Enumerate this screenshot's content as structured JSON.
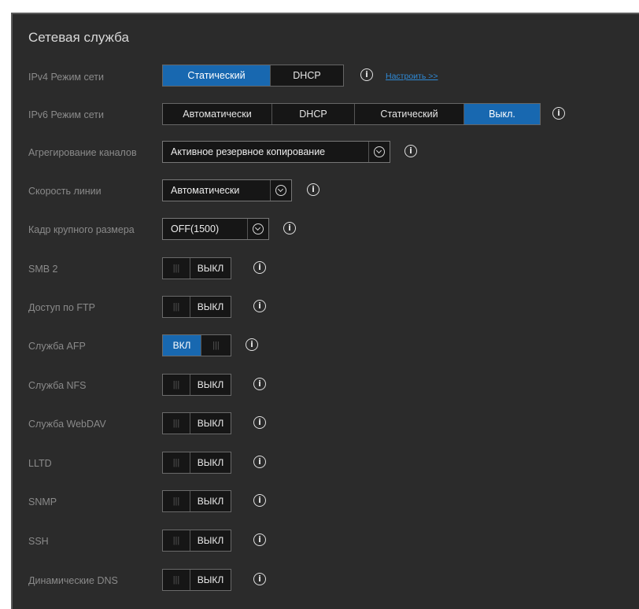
{
  "section_title": "Сетевая служба",
  "ipv4": {
    "label": "IPv4 Режим сети",
    "options": [
      "Статический",
      "DHCP"
    ],
    "selected": "Статический",
    "configure_link": "Настроить >>"
  },
  "ipv6": {
    "label": "IPv6 Режим сети",
    "options": [
      "Автоматически",
      "DHCP",
      "Статический",
      "Выкл."
    ],
    "selected": "Выкл."
  },
  "link_aggregation": {
    "label": "Агрегирование каналов",
    "value": "Активное резервное копирование"
  },
  "link_speed": {
    "label": "Скорость линии",
    "value": "Автоматически"
  },
  "jumbo_frame": {
    "label": "Кадр крупного размера",
    "value": "OFF(1500)"
  },
  "toggles": [
    {
      "label": "SMB 2",
      "state": "ВЫКЛ",
      "on": false
    },
    {
      "label": "Доступ по FTP",
      "state": "ВЫКЛ",
      "on": false
    },
    {
      "label": "Служба AFP",
      "state": "ВКЛ",
      "on": true
    },
    {
      "label": "Служба NFS",
      "state": "ВЫКЛ",
      "on": false
    },
    {
      "label": "Служба WebDAV",
      "state": "ВЫКЛ",
      "on": false
    },
    {
      "label": "LLTD",
      "state": "ВЫКЛ",
      "on": false
    },
    {
      "label": "SNMP",
      "state": "ВЫКЛ",
      "on": false
    },
    {
      "label": "SSH",
      "state": "ВЫКЛ",
      "on": false
    },
    {
      "label": "Динамические DNS",
      "state": "ВЫКЛ",
      "on": false
    }
  ],
  "grip_glyph": "|||",
  "info_glyph": "i",
  "colors": {
    "accent": "#1868b0",
    "background": "#2b2b2b",
    "link": "#2f8ad6"
  }
}
